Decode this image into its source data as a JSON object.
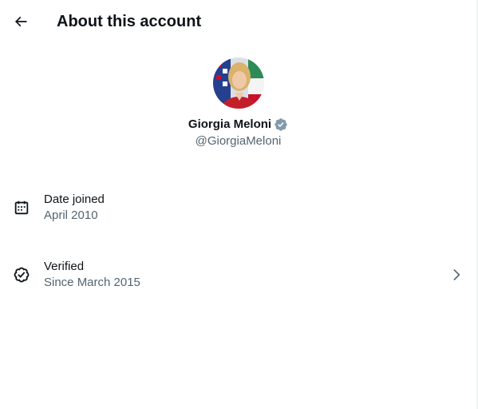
{
  "header": {
    "title": "About this account",
    "back_icon": "arrow-left-icon"
  },
  "profile": {
    "name": "Giorgia Meloni",
    "handle": "@GiorgiaMeloni",
    "verified_badge_color": "#829aab",
    "avatar": "profile-photo"
  },
  "details": [
    {
      "icon": "calendar-icon",
      "label": "Date joined",
      "value": "April 2010"
    },
    {
      "icon": "verified-check-icon",
      "label": "Verified",
      "value": "Since March 2015",
      "action_icon": "chevron-right-icon"
    }
  ],
  "colors": {
    "primary_text": "#0f1419",
    "secondary_text": "#536471",
    "background": "#ffffff"
  }
}
